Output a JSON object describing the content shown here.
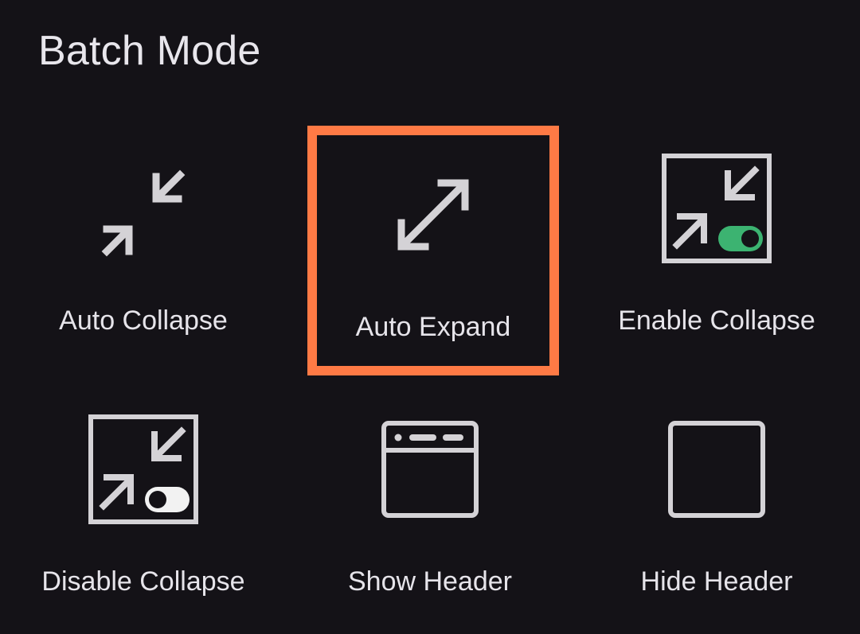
{
  "header": {
    "title": "Batch Mode"
  },
  "tiles": [
    {
      "label": "Auto Collapse",
      "icon": "collapse-arrows-icon",
      "selected": false
    },
    {
      "label": "Auto Expand",
      "icon": "expand-arrows-icon",
      "selected": true
    },
    {
      "label": "Enable Collapse",
      "icon": "collapse-toggle-on-icon",
      "selected": false
    },
    {
      "label": "Disable Collapse",
      "icon": "collapse-toggle-off-icon",
      "selected": false
    },
    {
      "label": "Show Header",
      "icon": "window-header-icon",
      "selected": false
    },
    {
      "label": "Hide Header",
      "icon": "empty-window-icon",
      "selected": false
    }
  ],
  "colors": {
    "background": "#141217",
    "text": "#e6e4ea",
    "icon": "#d4d2d6",
    "selection": "#ff7a45",
    "toggle_on": "#3cb371",
    "toggle_off": "#f2f2f2"
  }
}
